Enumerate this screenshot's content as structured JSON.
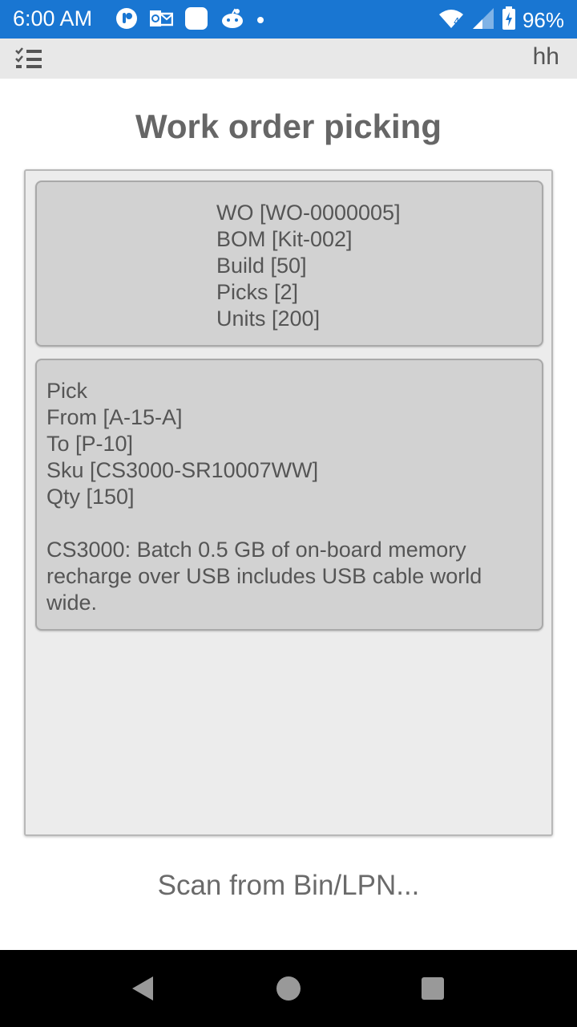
{
  "status_bar": {
    "time": "6:00 AM",
    "battery": "96%",
    "notification_icons": [
      "reader-icon",
      "outlook-icon",
      "square-app-icon",
      "reddit-icon",
      "dot-icon"
    ],
    "network_badge": "4"
  },
  "app_bar": {
    "user": "hh"
  },
  "page": {
    "title": "Work order picking"
  },
  "work_order": {
    "wo": "WO [WO-0000005]",
    "bom": "BOM [Kit-002]",
    "build": "Build [50]",
    "picks": "Picks [2]",
    "units": "Units [200]"
  },
  "pick": {
    "heading": "Pick",
    "from": "From [A-15-A]",
    "to": "To [P-10]",
    "sku": "Sku [CS3000-SR10007WW]",
    "qty": "Qty [150]",
    "description": "CS3000: Batch 0.5 GB of on-board memory recharge over USB includes USB cable world wide."
  },
  "scan": {
    "prompt": "Scan from Bin/LPN..."
  },
  "colors": {
    "status_bar": "#1976d2",
    "app_bar": "#e8e8e8",
    "card": "#d2d2d2",
    "panel": "#ececec"
  }
}
